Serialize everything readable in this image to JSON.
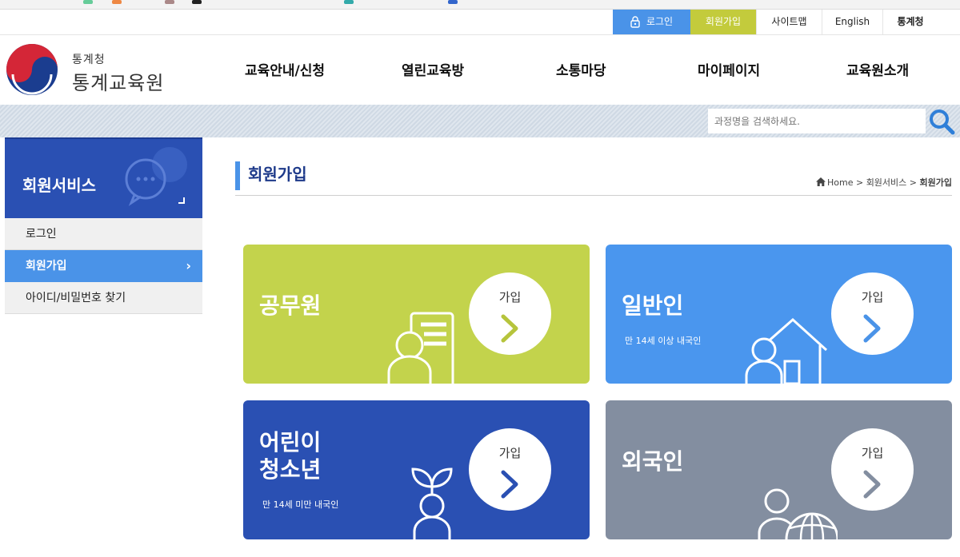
{
  "util_nav": {
    "login": "로그인",
    "join": "회원가입",
    "sitemap": "사이트맵",
    "english": "English",
    "kostat": "통계청"
  },
  "logo": {
    "small": "통계청",
    "big": "통계교육원"
  },
  "gnb": [
    {
      "label": "교육안내/신청"
    },
    {
      "label": "열린교육방"
    },
    {
      "label": "소통마당"
    },
    {
      "label": "마이페이지"
    },
    {
      "label": "교육원소개"
    }
  ],
  "search": {
    "placeholder": "과정명을 검색하세요."
  },
  "sidebar": {
    "title": "회원서비스",
    "items": [
      {
        "label": "로그인"
      },
      {
        "label": "회원가입",
        "arrow": "›"
      },
      {
        "label": "아이디/비밀번호 찾기"
      }
    ]
  },
  "page": {
    "title": "회원가입",
    "breadcrumb": {
      "home": "Home",
      "sep": ">",
      "section": "회원서비스",
      "current": "회원가입"
    }
  },
  "cards": [
    {
      "title": "공무원",
      "desc": "",
      "button": "가입",
      "color": "#c3d34c",
      "arrow_color": "#b6c43c",
      "icon": "document-person-icon"
    },
    {
      "title": "일반인",
      "desc": "만 14세 이상 내국인",
      "button": "가입",
      "color": "#4a96ee",
      "arrow_color": "#4a93e8",
      "icon": "house-person-icon"
    },
    {
      "title_line1": "어린이",
      "title_line2": "청소년",
      "desc": "만 14세 미만 내국인",
      "button": "가입",
      "color": "#2a50b3",
      "arrow_color": "#2a50b3",
      "icon": "sprout-person-icon"
    },
    {
      "title": "외국인",
      "desc": "",
      "button": "가입",
      "color": "#838ea0",
      "arrow_color": "#838ea0",
      "icon": "globe-person-icon"
    }
  ],
  "colors": {
    "primary_blue": "#2a50b3",
    "accent_blue": "#4a93e8",
    "accent_green": "#c3cb3c"
  }
}
